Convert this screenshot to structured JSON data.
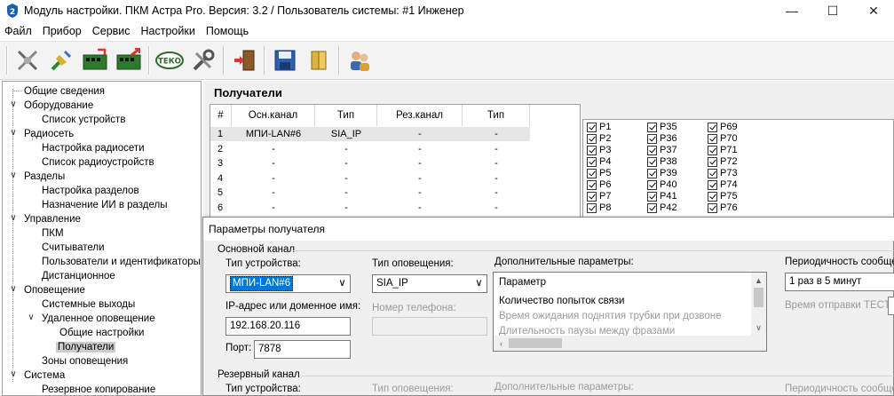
{
  "window": {
    "title": "Модуль настройки. ПКМ Астра Pro. Версия: 3.2 / Пользователь системы: #1 Инженер",
    "minimize": "—",
    "maximize": "☐",
    "close": "✕"
  },
  "menu": [
    "Файл",
    "Прибор",
    "Сервис",
    "Настройки",
    "Помощь"
  ],
  "toolbar": {
    "icons": [
      "disconnect-icon",
      "usb-connect-icon",
      "read-device-icon",
      "write-device-icon",
      "teko-icon",
      "tools-icon",
      "exit-icon",
      "save-icon",
      "open-icon",
      "users-icon"
    ],
    "teko_label": "ТЕКО"
  },
  "tree": {
    "items": [
      "Общие сведения",
      "Оборудование",
      "Список устройств",
      "Радиосеть",
      "Настройка радиосети",
      "Список радиоустройств",
      "Разделы",
      "Настройка разделов",
      "Назначение ИИ в разделы",
      "Управление",
      "ПКМ",
      "Считыватели",
      "Пользователи и идентификаторы",
      "Дистанционное",
      "Оповещение",
      "Системные выходы",
      "Удаленное оповещение",
      "Общие настройки",
      "Получатели",
      "Зоны оповещения",
      "Система",
      "Резервное копирование"
    ]
  },
  "receivers": {
    "title": "Получатели",
    "columns": [
      "#",
      "Осн.канал",
      "Тип",
      "Рез.канал",
      "Тип"
    ],
    "rows": [
      [
        "1",
        "МПИ-LAN#6",
        "SIA_IP",
        "-",
        "-"
      ],
      [
        "2",
        "-",
        "-",
        "-",
        "-"
      ],
      [
        "3",
        "-",
        "-",
        "-",
        "-"
      ],
      [
        "4",
        "-",
        "-",
        "-",
        "-"
      ],
      [
        "5",
        "-",
        "-",
        "-",
        "-"
      ],
      [
        "6",
        "-",
        "-",
        "-",
        "-"
      ]
    ]
  },
  "partitions": {
    "col1": [
      "P1",
      "P2",
      "P3",
      "P4",
      "P5",
      "P6",
      "P7",
      "P8"
    ],
    "col2": [
      "P35",
      "P36",
      "P37",
      "P38",
      "P39",
      "P40",
      "P41",
      "P42"
    ],
    "col3": [
      "P69",
      "P70",
      "P71",
      "P72",
      "P73",
      "P74",
      "P75",
      "P76"
    ]
  },
  "dialog": {
    "title": "Параметры получателя",
    "main_group": "Основной канал",
    "device_type_label": "Тип устройства:",
    "device_type_value": "МПИ-LAN#6",
    "notify_type_label": "Тип оповещения:",
    "notify_type_value": "SIA_IP",
    "extra_params_label": "Дополнительные параметры:",
    "extra_params": [
      "Параметр",
      "Количество попыток связи",
      "Время ожидания поднятия трубки при дозвоне",
      "Длительность паузы между фразами"
    ],
    "period_label": "Периодичность сообщений",
    "period_value": "1 раз в 5 минут",
    "ip_label": "IP-адрес или доменное имя:",
    "ip_value": "192.168.20.116",
    "phone_label": "Номер телефона:",
    "phone_value": "",
    "test_time_label": "Время отправки ТЕСТ:",
    "port_label": "Порт:",
    "port_value": "7878",
    "backup_group": "Резервный канал",
    "backup_device_type_label": "Тип устройства:",
    "backup_notify_type_label": "Тип оповещения:",
    "backup_extra_params_label": "Дополнительные параметры:",
    "backup_period_label": "Периодичность сообщений"
  }
}
